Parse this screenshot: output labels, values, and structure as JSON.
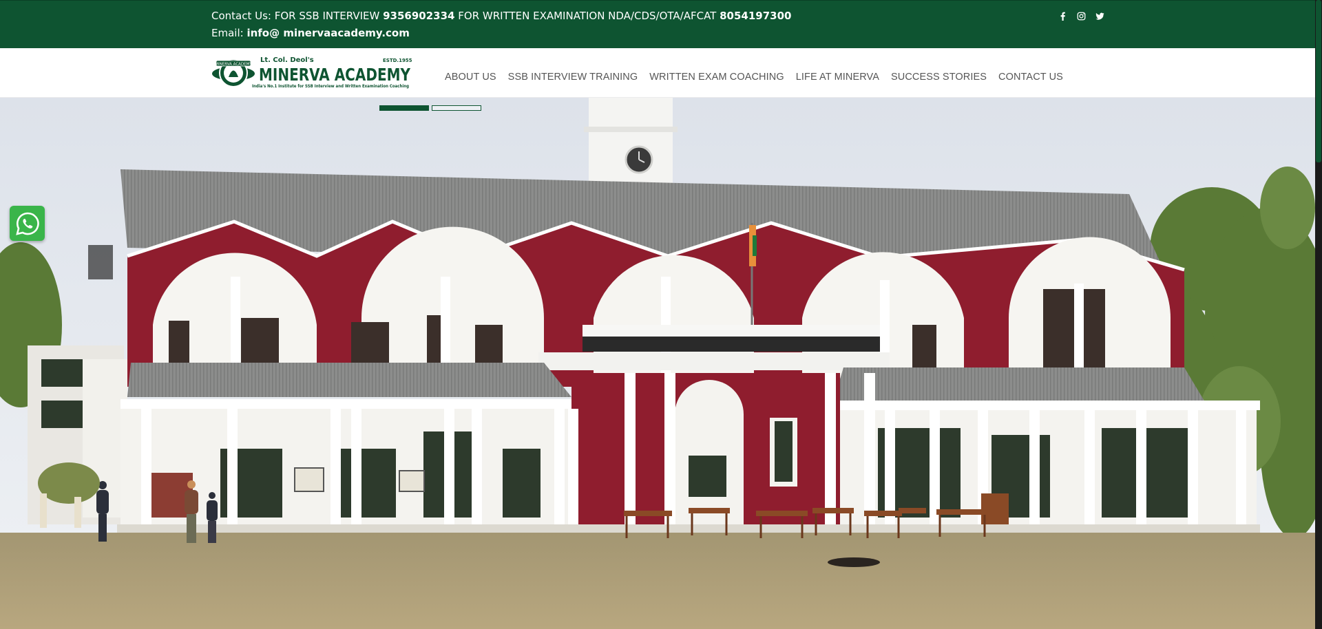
{
  "topbar": {
    "contact_prefix": "Contact Us: FOR SSB INTERVIEW ",
    "ssb_phone": "9356902334",
    "written_text": " FOR WRITTEN EXAMINATION NDA/CDS/OTA/AFCAT ",
    "written_phone": "8054197300",
    "email_prefix": "Email: ",
    "email": "info@ minervaacademy.com",
    "social_icons": [
      "facebook-icon",
      "instagram-icon",
      "twitter-icon"
    ]
  },
  "logo": {
    "top_text": "Lt. Col. Deol's",
    "name": "MINERVA ACADEMY",
    "estd": "ESTD.1955",
    "tagline": "India's No.1 Institute for SSB Interview and Written Examination Coaching",
    "badge_text": "MINERVA ACADEMY"
  },
  "nav": {
    "items": [
      "ABOUT US",
      "SSB INTERVIEW TRAINING",
      "WRITTEN EXAM COACHING",
      "LIFE AT MINERVA",
      "SUCCESS STORIES",
      "CONTACT US"
    ]
  },
  "slider": {
    "slide_count": 2,
    "active_index": 0
  },
  "colors": {
    "brand_green": "#0e5431",
    "building_red": "#8f1d2e",
    "roof_gray": "#8a8b8a",
    "nav_text": "#555555",
    "whatsapp_green": "#3ab54a"
  }
}
